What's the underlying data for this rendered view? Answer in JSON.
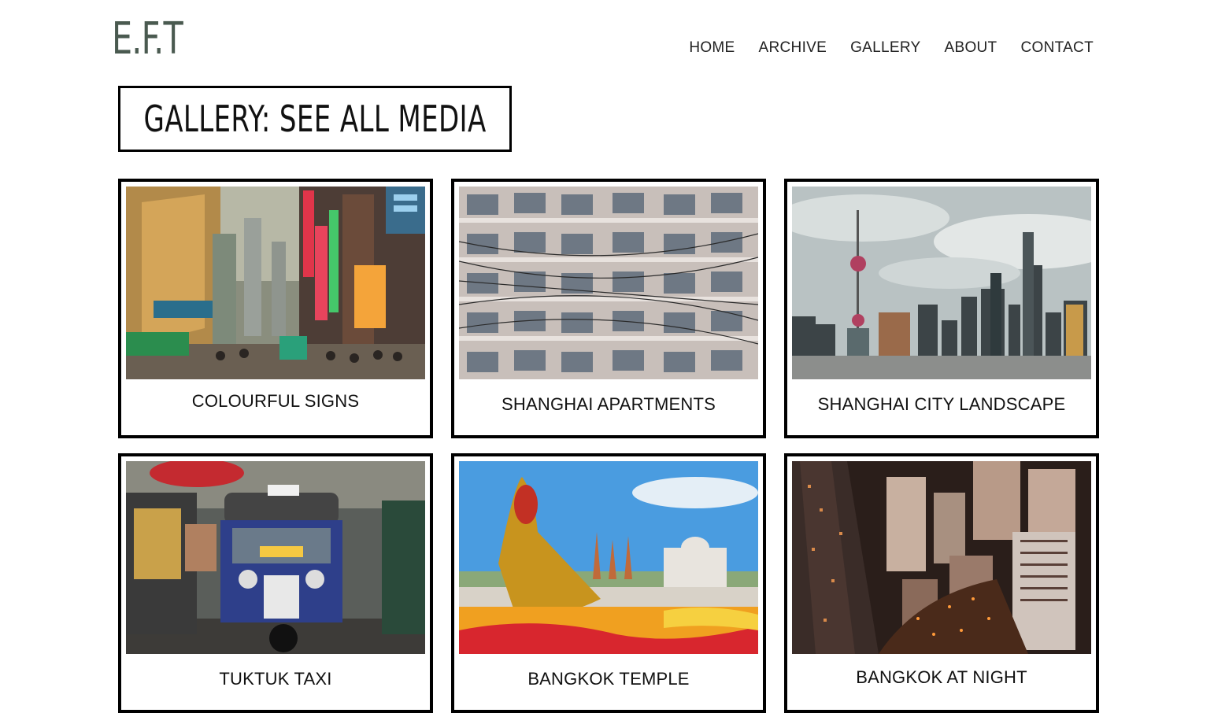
{
  "header": {
    "logo": "E.F.T",
    "nav": [
      "HOME",
      "ARCHIVE",
      "GALLERY",
      "ABOUT",
      "CONTACT"
    ]
  },
  "page_title": "GALLERY: SEE ALL MEDIA",
  "gallery": [
    {
      "caption": "COLOURFUL SIGNS",
      "image": "shanghai-street-neon-signs-photo"
    },
    {
      "caption": "SHANGHAI APARTMENTS",
      "image": "apartment-building-facade-photo"
    },
    {
      "caption": "SHANGHAI CITY LANDSCAPE",
      "image": "shanghai-skyline-photo"
    },
    {
      "caption": "TUKTUK TAXI",
      "image": "tuktuk-taxi-photo"
    },
    {
      "caption": "BANGKOK TEMPLE",
      "image": "bangkok-temple-flowers-photo"
    },
    {
      "caption": "BANGKOK AT NIGHT",
      "image": "bangkok-night-aerial-photo"
    }
  ]
}
